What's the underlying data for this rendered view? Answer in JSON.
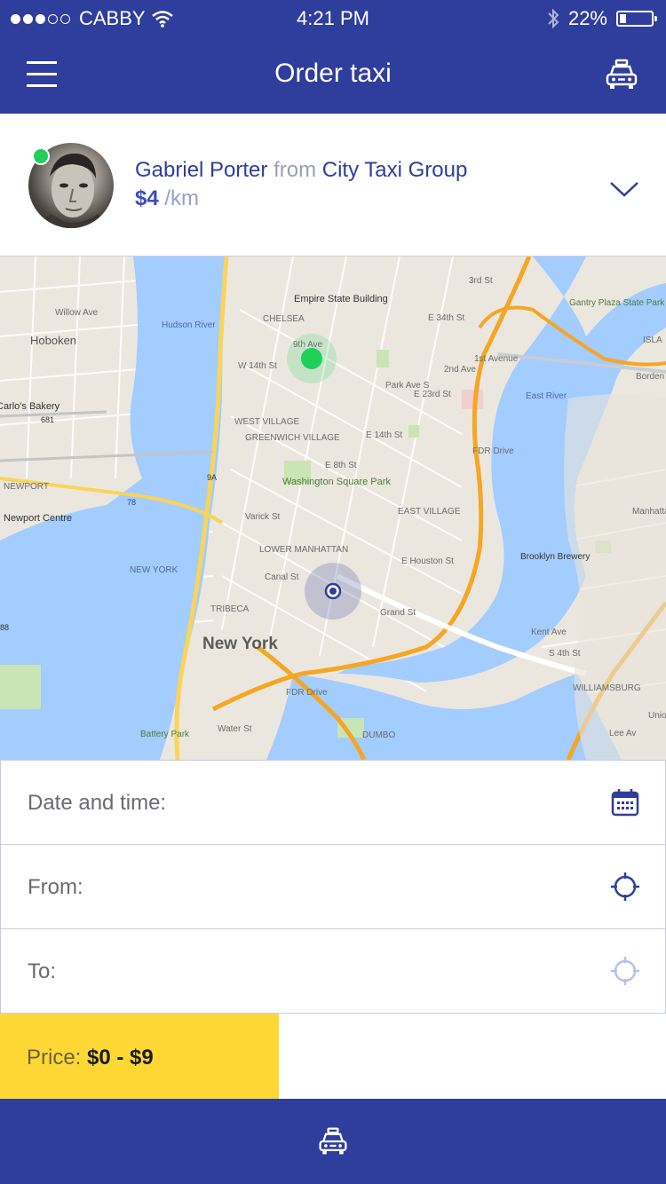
{
  "status_bar": {
    "carrier": "CABBY",
    "time": "4:21 PM",
    "battery_percent": "22%",
    "battery_level": 0.22,
    "signal_bars_filled": 3,
    "signal_bars_total": 5
  },
  "nav": {
    "title": "Order taxi"
  },
  "driver": {
    "name": "Gabriel Porter",
    "from_word": "from",
    "company": "City Taxi Group",
    "price": "$4",
    "price_unit": "/km",
    "online": true
  },
  "map": {
    "labels": {
      "hoboken": "Hoboken",
      "carlos_bakery": "Carlo's Bakery",
      "newport": "NEWPORT",
      "newport_centre": "Newport Centre",
      "hudson_river": "Hudson River",
      "empire_state": "Empire State Building",
      "chelsea": "CHELSEA",
      "west_village": "WEST VILLAGE",
      "greenwich_village": "GREENWICH VILLAGE",
      "washington_square": "Washington Square Park",
      "east_village": "EAST VILLAGE",
      "lower_manhattan": "LOWER MANHATTAN",
      "tribeca": "TRIBECA",
      "new_york": "New York",
      "battery_park": "Battery Park",
      "dumbo": "DUMBO",
      "williamsburg": "WILLIAMSBURG",
      "brooklyn_brewery": "Brooklyn Brewery",
      "gantry_plaza": "Gantry Plaza State Park",
      "east_river": "East River",
      "fdr_drive": "FDR Drive",
      "fdr_drive_2": "FDR Drive",
      "new_york_label": "NEW YORK",
      "e_houston": "E Houston St",
      "canal_st": "Canal St",
      "grand_st": "Grand St",
      "e_14th": "E 14th St",
      "w_14th": "W 14th St",
      "e_34th": "E 34th St",
      "e_23rd": "E 23rd St",
      "first_avenue": "1st Avenue",
      "second_ave": "2nd Ave",
      "park_ave": "Park Ave S",
      "kent_ave": "Kent Ave",
      "s_4th": "S 4th St",
      "isla": "ISLA",
      "borden": "Borden",
      "union_ave": "Union Ave",
      "manhattan_ave": "Manhattan Ave",
      "willow_ave": "Willow Ave",
      "water_st": "Water St",
      "varick_st": "Varick St",
      "e_8th": "E 8th St",
      "third_st": "3rd St",
      "ninth_ave": "9th Ave",
      "route_9a": "9A",
      "route_78": "78",
      "route_681": "681",
      "route_88": "88",
      "lee_av": "Lee Av"
    }
  },
  "form": {
    "date_label": "Date and time:",
    "from_label": "From:",
    "to_label": "To:"
  },
  "price": {
    "label": "Price:",
    "value": "$0 - $9"
  },
  "colors": {
    "primary": "#2f3d9c",
    "accent": "#fdd835",
    "online": "#1fcf5a"
  },
  "icons": {
    "menu": "hamburger-icon",
    "taxi": "taxi-icon",
    "chevron": "chevron-down-icon",
    "calendar": "calendar-icon",
    "locate": "crosshair-icon"
  }
}
